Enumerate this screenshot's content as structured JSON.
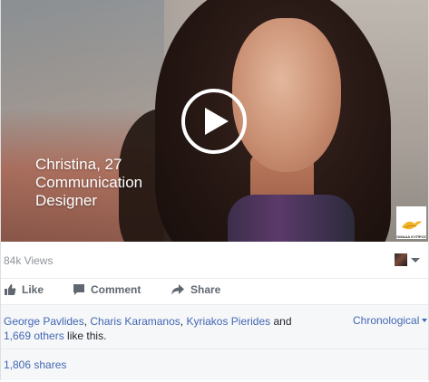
{
  "video": {
    "caption_line1": "Christina, 27",
    "caption_line2": "Communication",
    "caption_line3": "Designer",
    "logo_text": "ΟΜΑΔΑ ΚΥΠΡΟΣ",
    "play_icon": "play-icon"
  },
  "stats": {
    "views": "84k Views"
  },
  "actions": {
    "like": "Like",
    "comment": "Comment",
    "share": "Share"
  },
  "likes": {
    "person1": "George Pavlides",
    "sep1": ", ",
    "person2": "Charis Karamanos",
    "sep2": ", ",
    "person3": "Kyriakos Pierides",
    "and": " and ",
    "others": "1,669 others",
    "suffix": " like this."
  },
  "comments_order": "Chronological",
  "shares": "1,806 shares",
  "colors": {
    "link": "#4267b2",
    "muted": "#90949c",
    "panel": "#f6f7f9"
  }
}
